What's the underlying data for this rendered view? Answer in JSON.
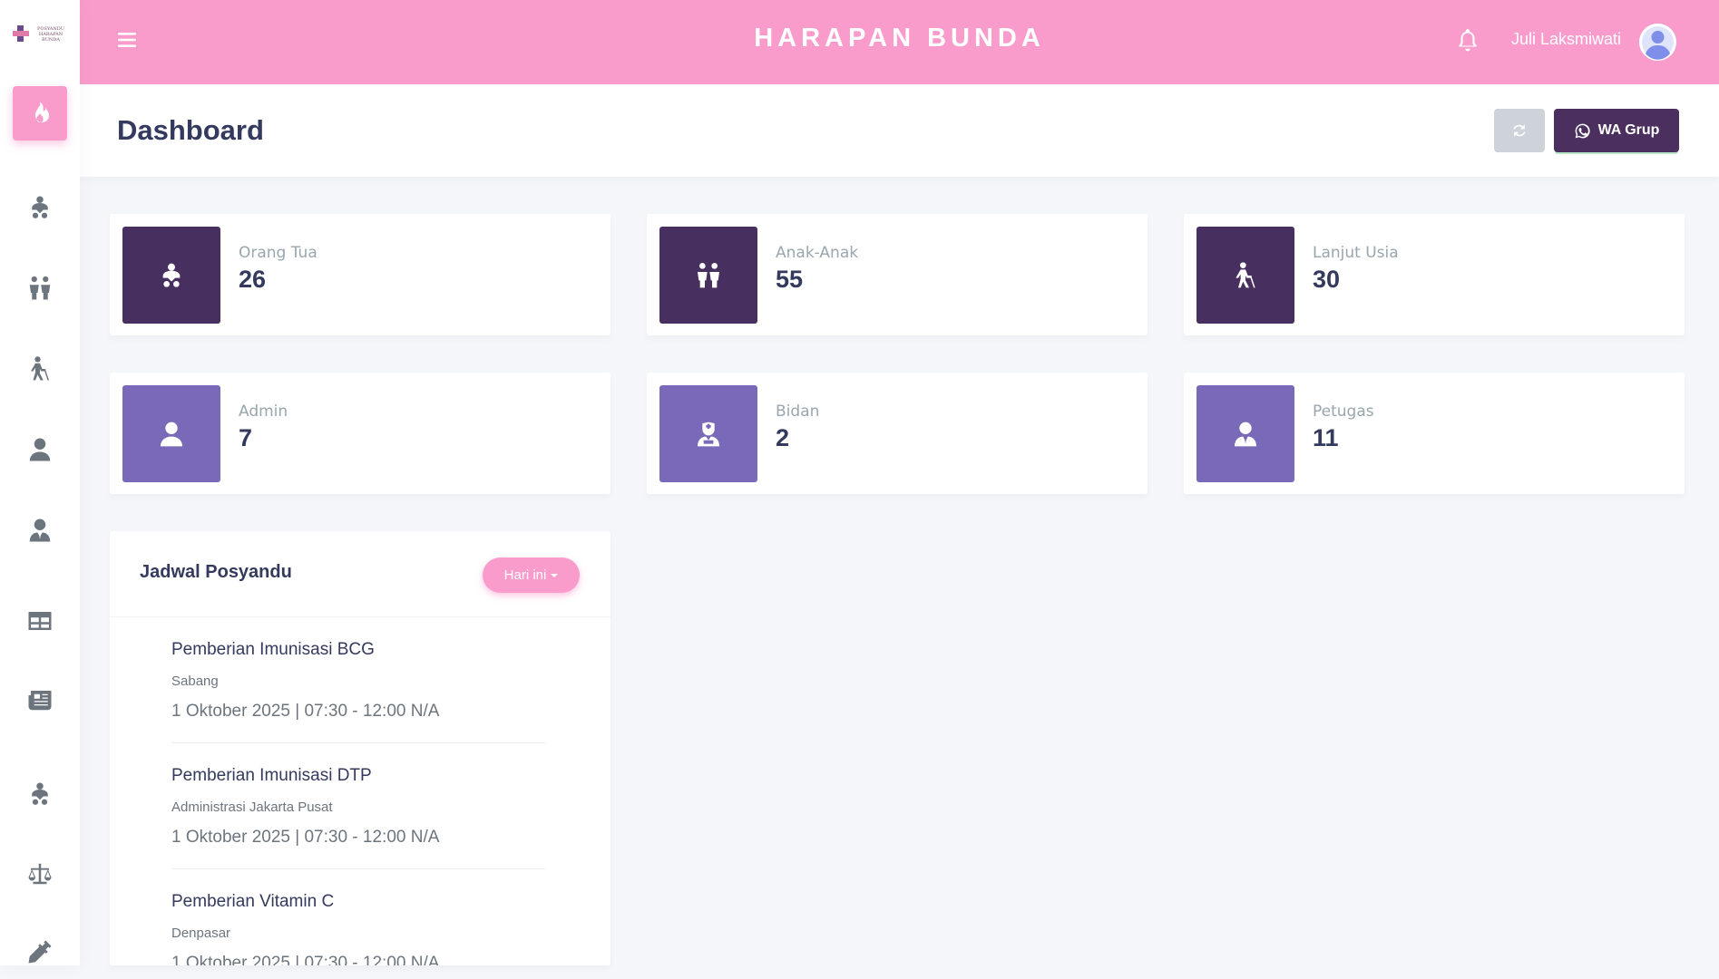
{
  "app": {
    "brand": "HARAPAN BUNDA",
    "logo_text": "POSYANDU HARAPAN BUNDA",
    "accent_color": "#f99ccc",
    "dark_color": "#47305f",
    "light_color": "#7a68b8"
  },
  "sidebar": {
    "items": [
      {
        "icon": "fire-icon",
        "active": true
      },
      {
        "icon": "baby-carriage-icon"
      },
      {
        "icon": "children-icon"
      },
      {
        "icon": "elderly-cane-icon"
      },
      {
        "icon": "user-icon"
      },
      {
        "icon": "user-tie-icon"
      },
      {
        "icon": "table-icon"
      },
      {
        "icon": "newspaper-icon"
      },
      {
        "icon": "baby-carriage-icon"
      },
      {
        "icon": "balance-scale-icon"
      },
      {
        "icon": "syringe-icon"
      }
    ]
  },
  "topbar": {
    "user_name": "Juli Laksmiwati"
  },
  "header": {
    "title": "Dashboard",
    "wa_button": "WA Grup"
  },
  "stats": [
    {
      "label": "Orang Tua",
      "value": "26",
      "icon": "parent-child-icon"
    },
    {
      "label": "Anak-Anak",
      "value": "55",
      "icon": "children-icon"
    },
    {
      "label": "Lanjut Usia",
      "value": "30",
      "icon": "elderly-cane-icon"
    },
    {
      "label": "Admin",
      "value": "7",
      "icon": "user-icon"
    },
    {
      "label": "Bidan",
      "value": "2",
      "icon": "nurse-icon"
    },
    {
      "label": "Petugas",
      "value": "11",
      "icon": "user-tie-icon"
    }
  ],
  "schedule": {
    "title": "Jadwal Posyandu",
    "filter_button": "Hari ini",
    "events": [
      {
        "title": "Pemberian Imunisasi BCG",
        "place": "Sabang",
        "time": "1 Oktober 2025 | 07:30 - 12:00 N/A"
      },
      {
        "title": "Pemberian Imunisasi DTP",
        "place": "Administrasi Jakarta Pusat",
        "time": "1 Oktober 2025 | 07:30 - 12:00 N/A"
      },
      {
        "title": "Pemberian Vitamin C",
        "place": "Denpasar",
        "time": "1 Oktober 2025 | 07:30 - 12:00 N/A"
      }
    ]
  }
}
